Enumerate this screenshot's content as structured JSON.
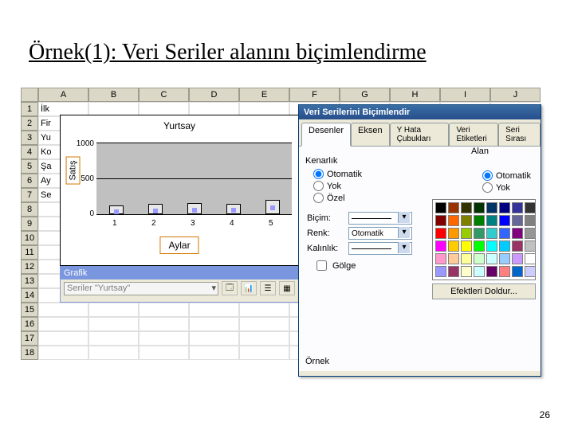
{
  "slide": {
    "title": "Örnek(1): Veri Seriler alanını biçimlendirme",
    "page_number": "26"
  },
  "sheet": {
    "columns": [
      "A",
      "B",
      "C",
      "D",
      "E",
      "F",
      "G",
      "H",
      "I",
      "J"
    ],
    "rows": [
      1,
      2,
      3,
      4,
      5,
      6,
      7,
      8,
      9,
      10,
      11,
      12,
      13,
      14,
      15,
      16,
      17,
      18
    ],
    "a_cells": [
      "İlk",
      "Fir",
      "Yu",
      "Ko",
      "Şa",
      "Ay",
      "Se",
      "",
      "",
      "",
      "",
      "",
      "",
      "",
      "",
      "",
      "",
      ""
    ]
  },
  "chart_data": {
    "type": "bar",
    "title": "Yurtsay",
    "ylabel": "Satış",
    "xlabel": "Aylar",
    "ylim": [
      0,
      1000
    ],
    "yticks": [
      0,
      500,
      1000
    ],
    "categories": [
      "1",
      "2",
      "3",
      "4",
      "5"
    ],
    "values": [
      120,
      140,
      160,
      150,
      200
    ]
  },
  "grafik_toolbar": {
    "title": "Grafik",
    "series_combo": "Seriler \"Yurtsay\""
  },
  "dialog": {
    "title": "Veri Serilerini Biçimlendir",
    "tabs": [
      "Desenler",
      "Eksen",
      "Y Hata Çubukları",
      "Veri Etiketleri",
      "Seri Sırası"
    ],
    "active_tab": "Desenler",
    "border": {
      "label": "Kenarlık",
      "options": [
        "Otomatik",
        "Yok",
        "Özel"
      ],
      "style": "Biçim:",
      "color": "Renk:",
      "color_value": "Otomatik",
      "weight": "Kalınlık:"
    },
    "shadow": "Gölge",
    "area": {
      "label": "Alan",
      "options": [
        "Otomatik",
        "Yok"
      ]
    },
    "effects_btn": "Efektleri Doldur...",
    "sample": "Örnek"
  },
  "palette": [
    "#000000",
    "#993300",
    "#333300",
    "#003300",
    "#003366",
    "#000080",
    "#333399",
    "#333333",
    "#800000",
    "#ff6600",
    "#808000",
    "#008000",
    "#008080",
    "#0000ff",
    "#666699",
    "#808080",
    "#ff0000",
    "#ff9900",
    "#99cc00",
    "#339966",
    "#33cccc",
    "#3366ff",
    "#800080",
    "#969696",
    "#ff00ff",
    "#ffcc00",
    "#ffff00",
    "#00ff00",
    "#00ffff",
    "#00ccff",
    "#993366",
    "#c0c0c0",
    "#ff99cc",
    "#ffcc99",
    "#ffff99",
    "#ccffcc",
    "#ccffff",
    "#99ccff",
    "#cc99ff",
    "#ffffff",
    "#9999ff",
    "#993366",
    "#ffffcc",
    "#ccffff",
    "#660066",
    "#ff8080",
    "#0066cc",
    "#ccccff"
  ]
}
